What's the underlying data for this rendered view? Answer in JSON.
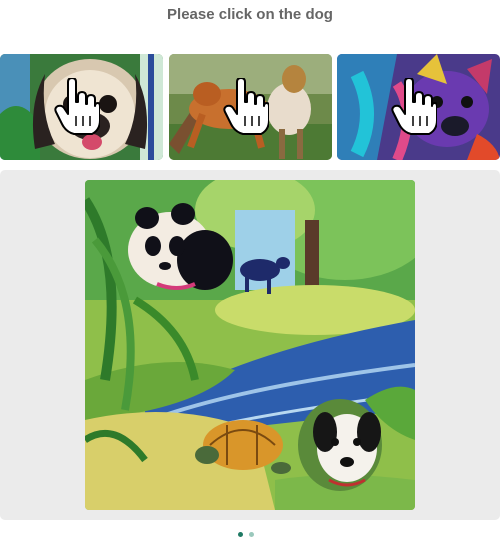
{
  "instruction": "Please click on the dog",
  "examples": [
    {
      "subject": "pug-dog",
      "icon": "hand-pointer-icon"
    },
    {
      "subject": "running-dog",
      "icon": "hand-pointer-icon"
    },
    {
      "subject": "colorful-dog",
      "icon": "hand-pointer-icon"
    }
  ],
  "challenge": {
    "objects": [
      "panda",
      "cow",
      "turtle",
      "dog"
    ],
    "scene": "watercolor jungle river"
  },
  "footer": {
    "left_text": "",
    "progress_steps": 2
  },
  "colors": {
    "panel_bg": "#ebebeb",
    "instruction_text": "#666666",
    "accent": "#1f7a64"
  }
}
